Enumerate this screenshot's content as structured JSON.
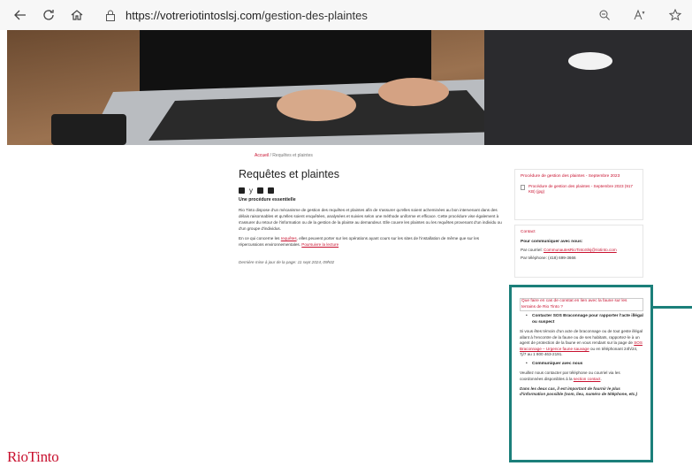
{
  "browser": {
    "url_host": "https://votreriotintoslsj.com",
    "url_path": "/gestion-des-plaintes",
    "icons": [
      "back-icon",
      "refresh-icon",
      "home-icon",
      "lock-icon",
      "zoom-icon",
      "read-aloud-icon",
      "favorite-icon"
    ]
  },
  "breadcrumb": {
    "home": "Accueil",
    "separator": "/",
    "current": "Requêtes et plaintes"
  },
  "main": {
    "title": "Requêtes et plaintes",
    "share_icons": [
      "facebook-icon",
      "twitter-icon",
      "linkedin-icon",
      "email-icon"
    ],
    "subhead": "Une procédure essentielle",
    "para1": "Rio Tinto dispose d'un mécanisme de gestion des requêtes et plaintes afin de s'assurer qu'elles soient acheminées au bon intervenant dans des délais raisonnables et qu'elles soient enquêtées, analysées et suivies selon une méthode uniforme et efficace. Cette procédure vise également à s'assurer du retour de l'information ou de la gestion de la plainte au demandeur. Elle couvre les plaintes ou les requêtes provenant d'un individu ou d'un groupe d'individus.",
    "para2_before": "En ce qui concerne les ",
    "para2_link": "requêtes",
    "para2_after": ", elles peuvent porter sur les opérations ayant cours sur les sites de l'installation de même que sur les répercussions environnementales. ",
    "para2_more": "Poursuivre la lecture",
    "updated": "Dernière mise à jour de la page: 11 sept 2024, 09h02"
  },
  "sidebar": {
    "box1_title": "Procédure de gestion des plaintes - Septembre 2023",
    "box1_file": "Procédure de gestion des plaintes - Septembre 2023 (917 KB) (jpg)",
    "box2_title": "Contact",
    "box2_strong": "Pour communiquer avec nous:",
    "box2_email_label": "Par courriel: ",
    "box2_email": "CommunautesRioTintoSlsj@riotinto.com",
    "box2_phone": "Par téléphone: (418) 699-3666"
  },
  "highlight": {
    "title": "Que faire en cas de constat en lien avec la faune sur les terrains de Rio Tinto ?",
    "bullet1": "Contacter SOS Braconnage pour rapporter l'acte illégal ou suspect",
    "para1_before": "Si vous êtes témoin d'un acte de braconnage ou de tout geste illégal allant à l'encontre de la faune ou de ses habitats, rapportez-le à un agent de protection de la faune en vous rendant sur la page de ",
    "para1_link": "SOS Braconnage – Urgence faune sauvage",
    "para1_after": " ou en téléphonant 24h/24, 7j/7 au 1 800 463-2191.",
    "bullet2": "Communiquer avec nous",
    "para2_before": "Veuillez nous contacter par téléphone ou courriel via les coordonnées disponibles à la ",
    "para2_link": "section contact",
    "para2_after": ".",
    "italic": "Dans les deux cas, il est important de fournir le plus d'information possible (nom, lieu, numéro de téléphone, etc.)"
  },
  "logo": "RioTinto",
  "colors": {
    "brand_red": "#c8102e",
    "highlight_teal": "#1b7f7a"
  }
}
